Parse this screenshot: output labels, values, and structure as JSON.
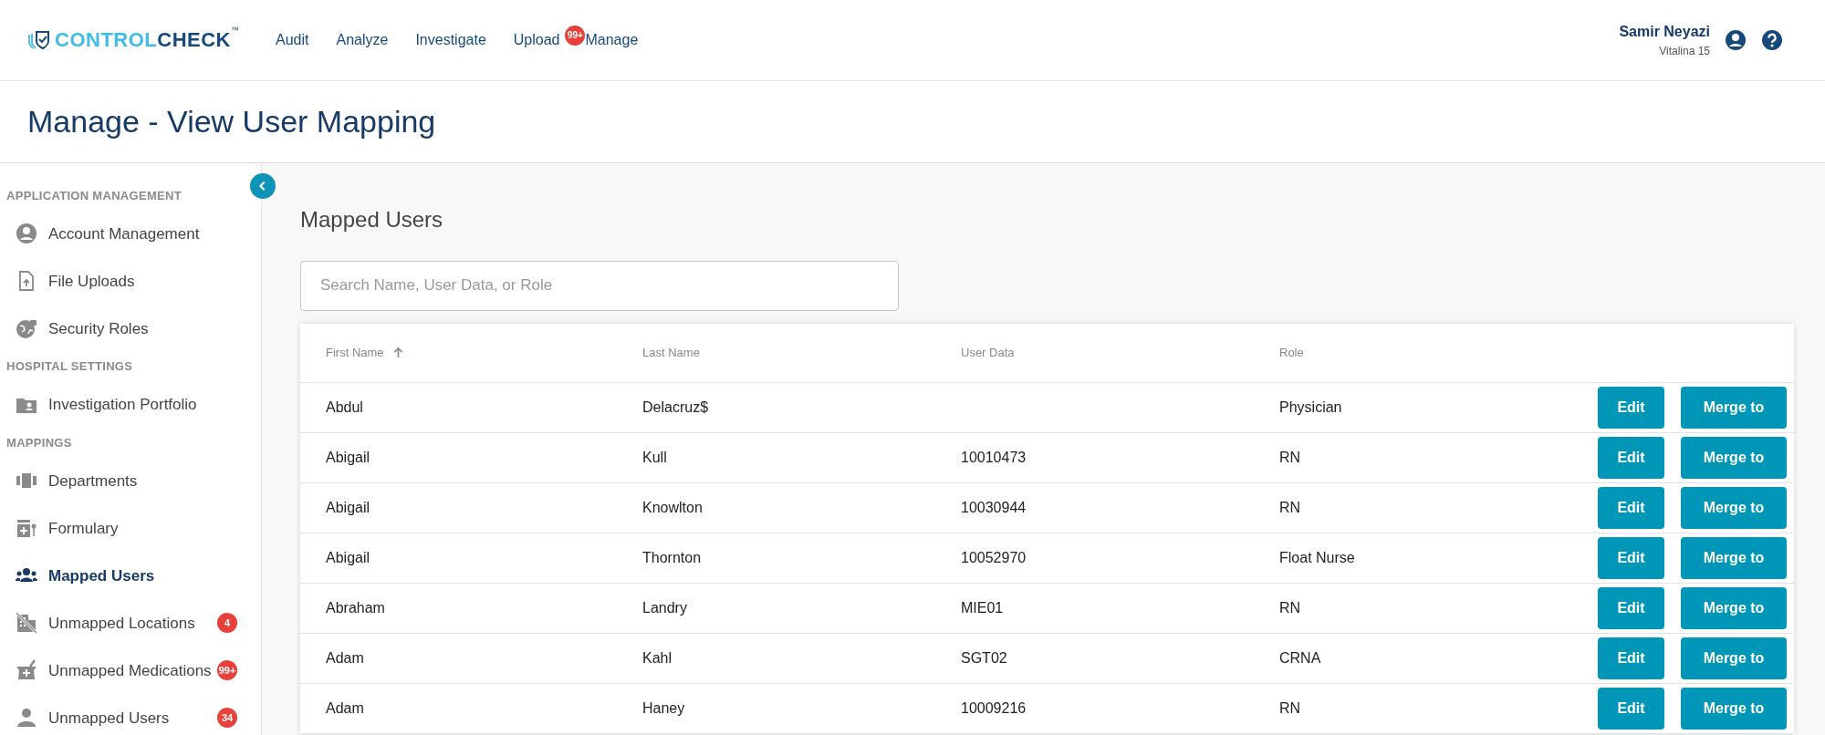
{
  "header": {
    "logo": {
      "part_1": "CONTROL",
      "part_2": "CHECK",
      "tm": "™"
    },
    "nav": [
      {
        "label": "Audit"
      },
      {
        "label": "Analyze"
      },
      {
        "label": "Investigate"
      },
      {
        "label": "Upload",
        "badge": "99+"
      },
      {
        "label": "Manage"
      }
    ],
    "user": {
      "name": "Samir Neyazi",
      "facility": "Vitalina 15"
    }
  },
  "page_title": "Manage - View User Mapping",
  "sidebar": {
    "sections": [
      {
        "title": "APPLICATION MANAGEMENT",
        "items": [
          {
            "label": "Account Management",
            "selected": false
          },
          {
            "label": "File Uploads",
            "selected": false
          },
          {
            "label": "Security Roles",
            "selected": false
          }
        ]
      },
      {
        "title": "HOSPITAL SETTINGS",
        "items": [
          {
            "label": "Investigation Portfolio",
            "selected": false
          }
        ]
      },
      {
        "title": "MAPPINGS",
        "items": [
          {
            "label": "Departments",
            "selected": false
          },
          {
            "label": "Formulary",
            "selected": false
          },
          {
            "label": "Mapped Users",
            "selected": true
          },
          {
            "label": "Unmapped Locations",
            "selected": false,
            "badge": "4"
          },
          {
            "label": "Unmapped Medications",
            "selected": false,
            "badge": "99+"
          },
          {
            "label": "Unmapped Users",
            "selected": false,
            "badge": "34"
          }
        ]
      }
    ]
  },
  "main": {
    "title": "Mapped Users",
    "search": {
      "placeholder": "Search Name, User Data, or Role"
    },
    "table": {
      "columns": [
        {
          "label": "First Name",
          "sorted": true
        },
        {
          "label": "Last Name",
          "sorted": false
        },
        {
          "label": "User Data",
          "sorted": false
        },
        {
          "label": "Role",
          "sorted": false
        }
      ],
      "rows": [
        {
          "cells": [
            "Abdul",
            "Delacruz$",
            "",
            "Physician"
          ],
          "actions": [
            "Edit",
            "Merge to"
          ]
        },
        {
          "cells": [
            "Abigail",
            "Kull",
            "10010473",
            "RN"
          ],
          "actions": [
            "Edit",
            "Merge to"
          ]
        },
        {
          "cells": [
            "Abigail",
            "Knowlton",
            "10030944",
            "RN"
          ],
          "actions": [
            "Edit",
            "Merge to"
          ]
        },
        {
          "cells": [
            "Abigail",
            "Thornton",
            "10052970",
            "Float Nurse"
          ],
          "actions": [
            "Edit",
            "Merge to"
          ]
        },
        {
          "cells": [
            "Abraham",
            "Landry",
            "MIE01",
            "RN"
          ],
          "actions": [
            "Edit",
            "Merge to"
          ]
        },
        {
          "cells": [
            "Adam",
            "Kahl",
            "SGT02",
            "CRNA"
          ],
          "actions": [
            "Edit",
            "Merge to"
          ]
        },
        {
          "cells": [
            "Adam",
            "Haney",
            "10009216",
            "RN"
          ],
          "actions": [
            "Edit",
            "Merge to"
          ]
        }
      ]
    }
  }
}
